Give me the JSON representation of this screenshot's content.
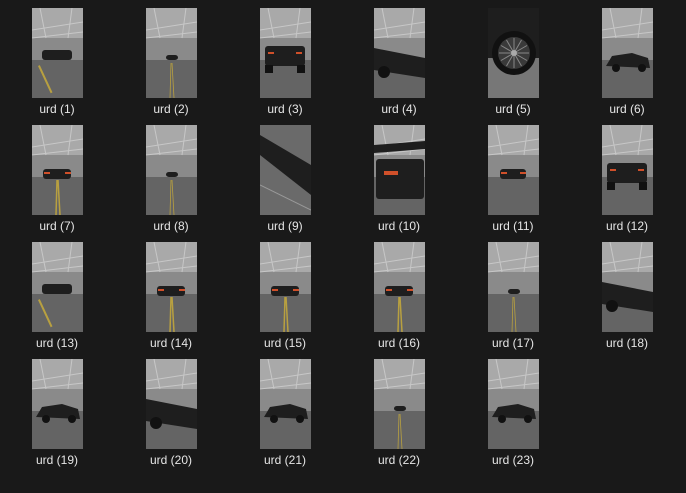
{
  "files": [
    {
      "name": "urd (1)",
      "thumbnail": "parking-garage-car-front"
    },
    {
      "name": "urd (2)",
      "thumbnail": "parking-garage-distant-car"
    },
    {
      "name": "urd (3)",
      "thumbnail": "car-rear-taillights"
    },
    {
      "name": "urd (4)",
      "thumbnail": "car-side-low-angle"
    },
    {
      "name": "urd (5)",
      "thumbnail": "wheel-closeup"
    },
    {
      "name": "urd (6)",
      "thumbnail": "car-side-profile"
    },
    {
      "name": "urd (7)",
      "thumbnail": "car-rear-lane-lines"
    },
    {
      "name": "urd (8)",
      "thumbnail": "parking-garage-distant-car"
    },
    {
      "name": "urd (9)",
      "thumbnail": "car-body-closeup"
    },
    {
      "name": "urd (10)",
      "thumbnail": "car-rear-spoiler-closeup"
    },
    {
      "name": "urd (11)",
      "thumbnail": "car-rear-garage"
    },
    {
      "name": "urd (12)",
      "thumbnail": "car-rear-taillights"
    },
    {
      "name": "urd (13)",
      "thumbnail": "parking-garage-car-front"
    },
    {
      "name": "urd (14)",
      "thumbnail": "car-rear-lane-lines"
    },
    {
      "name": "urd (15)",
      "thumbnail": "car-rear-lane-lines"
    },
    {
      "name": "urd (16)",
      "thumbnail": "car-rear-lane-lines"
    },
    {
      "name": "urd (17)",
      "thumbnail": "parking-garage-distant-car"
    },
    {
      "name": "urd (18)",
      "thumbnail": "car-side-low-angle"
    },
    {
      "name": "urd (19)",
      "thumbnail": "car-side-profile"
    },
    {
      "name": "urd (20)",
      "thumbnail": "car-side-low-angle"
    },
    {
      "name": "urd (21)",
      "thumbnail": "car-side-profile"
    },
    {
      "name": "urd (22)",
      "thumbnail": "parking-garage-distant-car"
    },
    {
      "name": "urd (23)",
      "thumbnail": "car-side-profile"
    }
  ],
  "colors": {
    "background": "#191919",
    "caption": "#e6e6e6",
    "thumbnail_base": "#6f6f6f",
    "car_body": "#1e1e1e",
    "taillight": "#d0502a",
    "lane_line": "#b8a040"
  }
}
